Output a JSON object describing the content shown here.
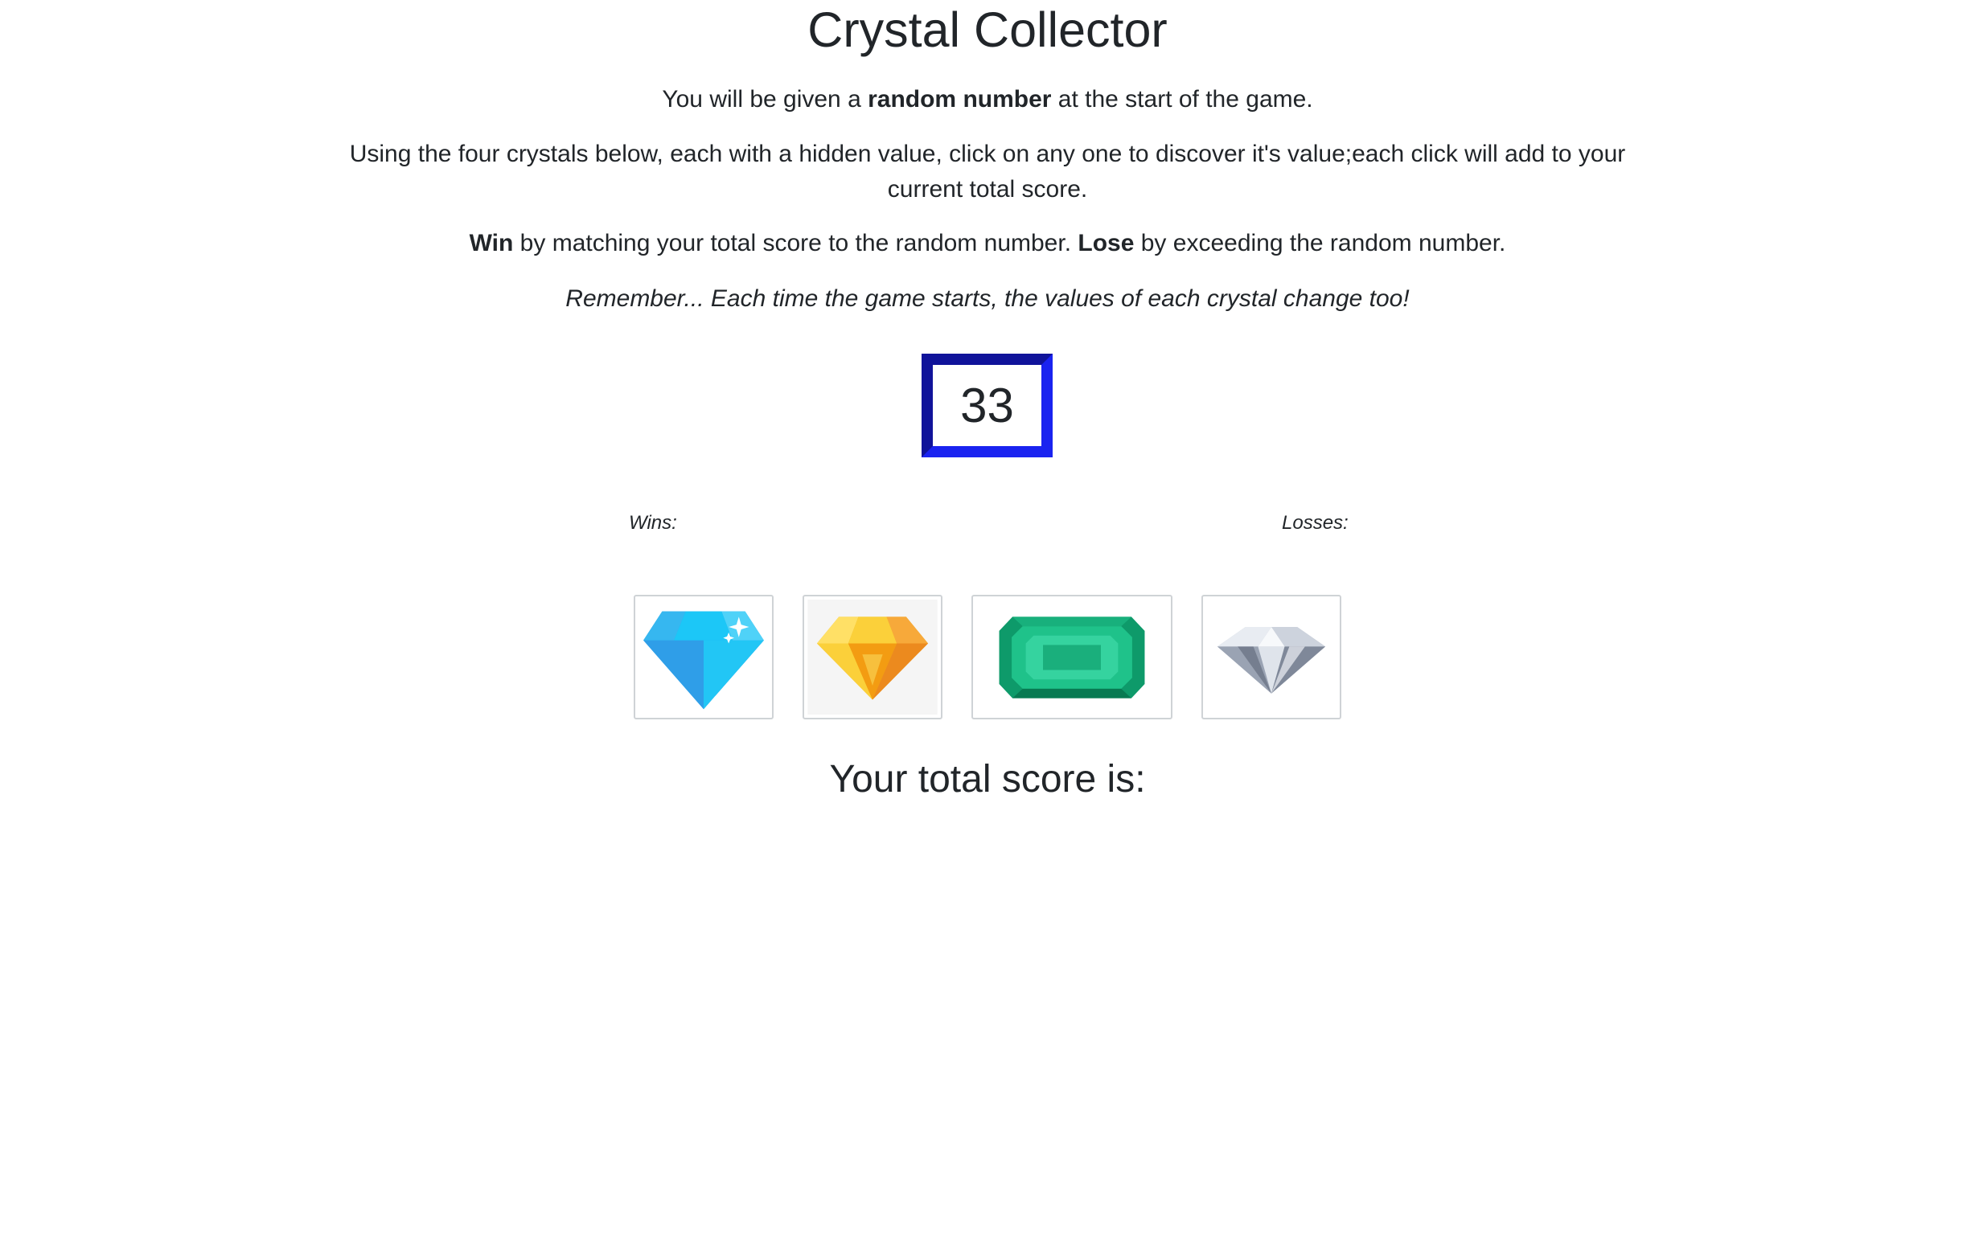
{
  "game": {
    "title": "Crystal Collector",
    "instructions": {
      "line1": {
        "before": "You will be given a ",
        "bold": "random number",
        "after": " at the start of the game."
      },
      "line2": "Using the four crystals below, each with a hidden value, click on any one to discover it's value;each click will add to your current total score.",
      "line3": {
        "win_bold": "Win",
        "win_text": " by matching your total score to the random number. ",
        "lose_bold": "Lose",
        "lose_text": " by exceeding the random number."
      },
      "line4": "Remember... Each time the game starts, the values of each crystal change too!"
    },
    "random_number": "33",
    "wins_label": "Wins:",
    "losses_label": "Losses:",
    "crystals": [
      {
        "name": "blue-diamond-icon"
      },
      {
        "name": "yellow-gem-icon"
      },
      {
        "name": "green-emerald-icon"
      },
      {
        "name": "clear-diamond-icon"
      }
    ],
    "score_label": "Your total score is:"
  },
  "colors": {
    "target_border_dark": "#10139a",
    "target_border_light": "#1a23f0",
    "text": "#212529"
  }
}
